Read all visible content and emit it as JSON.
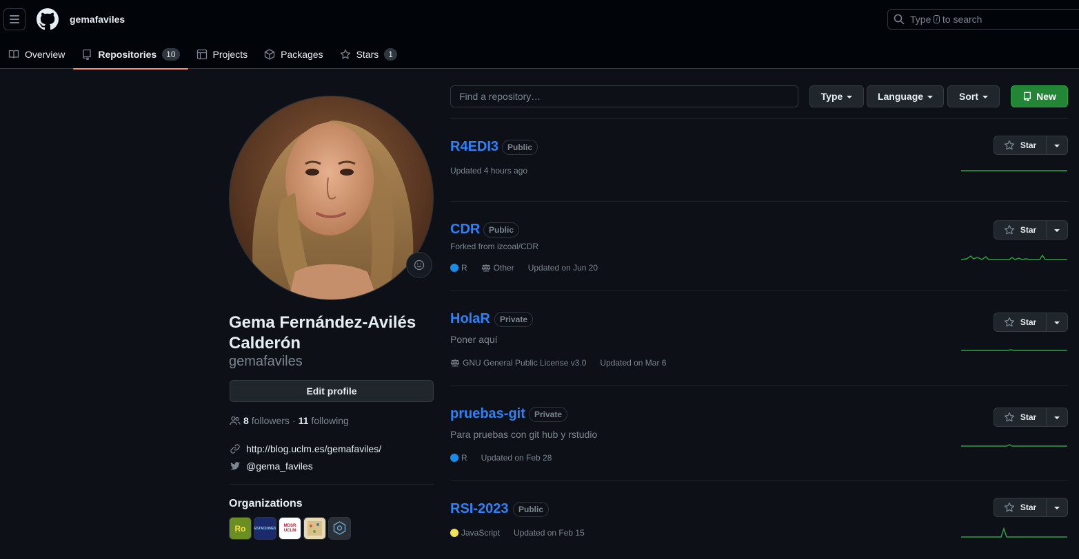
{
  "header": {
    "username": "gemafaviles",
    "search_prefix": "Type",
    "search_key": "/",
    "search_suffix": "to search"
  },
  "tabs": [
    {
      "label": "Overview",
      "icon": "book-icon"
    },
    {
      "label": "Repositories",
      "icon": "repo-icon",
      "count": "10",
      "active": true
    },
    {
      "label": "Projects",
      "icon": "table-icon"
    },
    {
      "label": "Packages",
      "icon": "package-icon"
    },
    {
      "label": "Stars",
      "icon": "star-icon",
      "count": "1"
    }
  ],
  "profile": {
    "fullname": "Gema Fernández-Avilés Calderón",
    "login": "gemafaviles",
    "edit_label": "Edit profile",
    "followers_count": "8",
    "followers_label": "followers",
    "separator": "·",
    "following_count": "11",
    "following_label": "following",
    "website": "http://blog.uclm.es/gemafaviles/",
    "twitter": "@gema_faviles",
    "orgs_title": "Organizations"
  },
  "organizations": [
    {
      "label": "Ro",
      "bg": "#6b8e23"
    },
    {
      "label": "ESTACIONES",
      "bg": "#1b2a6b"
    },
    {
      "label": "MDSR UCLM",
      "bg": "#ffffff"
    },
    {
      "label": "",
      "bg": "#e8d9b5"
    },
    {
      "label": "",
      "bg": "#2b2f36"
    }
  ],
  "filters": {
    "find_placeholder": "Find a repository…",
    "type_label": "Type",
    "language_label": "Language",
    "sort_label": "Sort",
    "new_label": "New"
  },
  "star_label": "Star",
  "repos": [
    {
      "name": "R4EDI3",
      "visibility": "Public",
      "updated": "Updated 4 hours ago"
    },
    {
      "name": "CDR",
      "visibility": "Public",
      "forked": "Forked from izcoal/CDR",
      "language": "R",
      "lang_color": "#198ce7",
      "license": "Other",
      "updated": "Updated on Jun 20"
    },
    {
      "name": "HolaR",
      "visibility": "Private",
      "description": "Poner aquí",
      "license": "GNU General Public License v3.0",
      "updated": "Updated on Mar 6"
    },
    {
      "name": "pruebas-git",
      "visibility": "Private",
      "description": "Para pruebas con git hub y rstudio",
      "language": "R",
      "lang_color": "#198ce7",
      "updated": "Updated on Feb 28"
    },
    {
      "name": "RSI-2023",
      "visibility": "Public",
      "language": "JavaScript",
      "lang_color": "#f1e05a",
      "updated": "Updated on Feb 15"
    }
  ],
  "colors": {
    "accent": "#2f81f7",
    "tab_underline": "#fd8c73",
    "new_button": "#238636",
    "sparkline": "#2ea043"
  }
}
